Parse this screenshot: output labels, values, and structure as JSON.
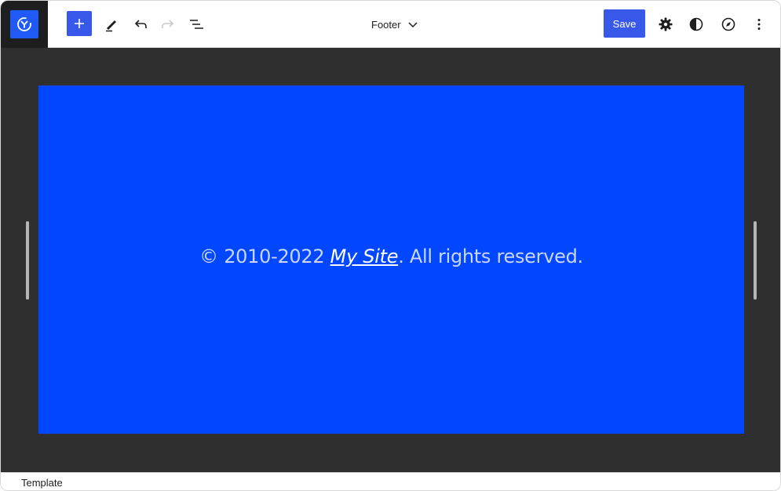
{
  "toolbar": {
    "logo_icon": "site-logo-icon",
    "inserter_icon": "plus-icon",
    "tools_icon": "pencil-icon",
    "undo_icon": "undo-icon",
    "redo_icon": "redo-icon",
    "list_view_icon": "list-view-icon",
    "document_title": "Footer",
    "save_label": "Save",
    "settings_icon": "gear-icon",
    "styles_icon": "half-circle-icon",
    "browse_icon": "compass-icon",
    "options_icon": "more-vertical-icon"
  },
  "canvas": {
    "footer": {
      "prefix": "© 2010-2022 ",
      "site_link": "My Site",
      "suffix": ". All rights reserved."
    },
    "colors": {
      "block_background": "#0047ff",
      "canvas_background": "#2f2f2f",
      "accent": "#3858e9"
    }
  },
  "statusbar": {
    "breadcrumb": "Template"
  }
}
